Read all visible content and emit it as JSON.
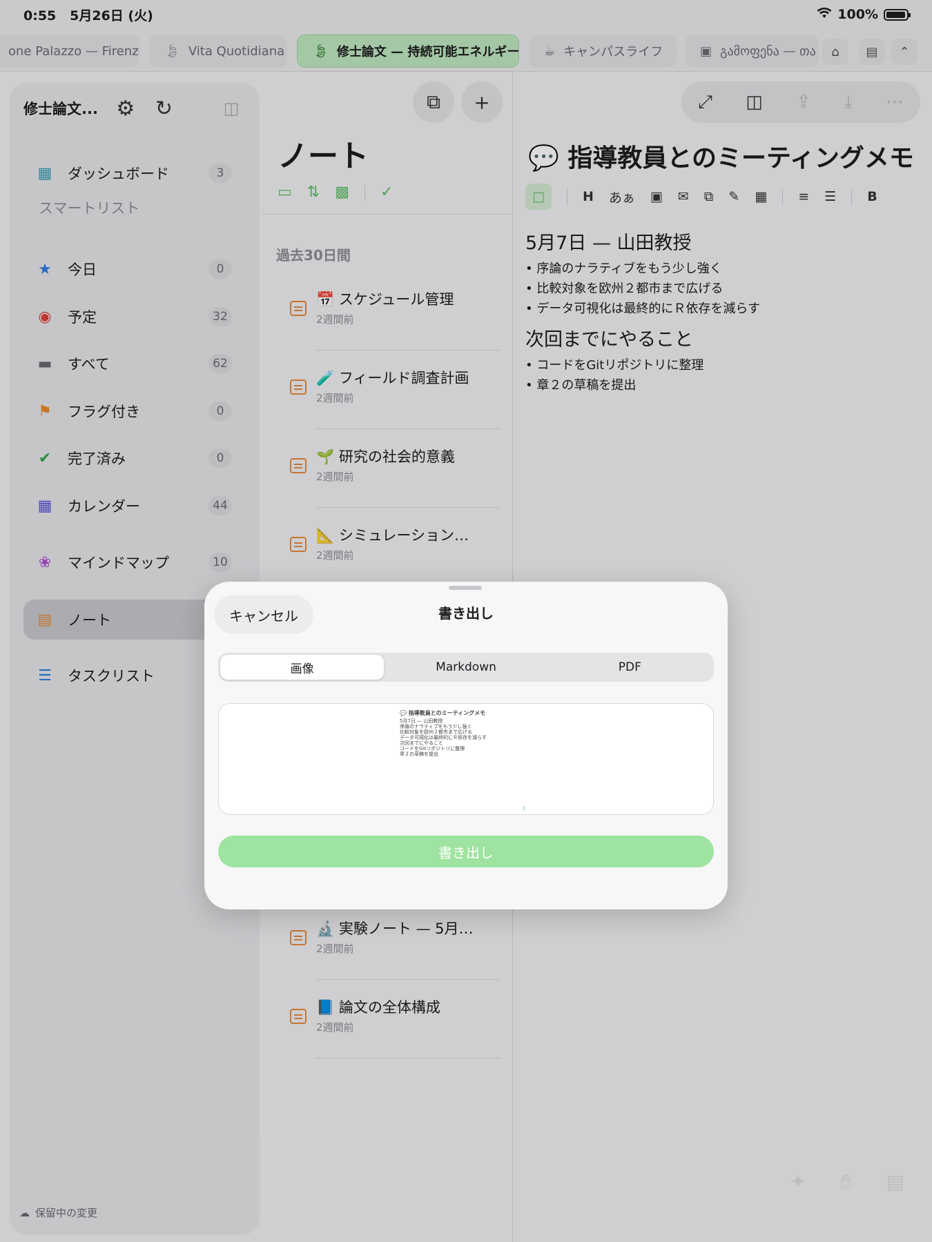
{
  "status": {
    "time": "0:55",
    "date": "5月26日 (火)",
    "battery": "100%",
    "battery_level": 0.95
  },
  "tabs": [
    {
      "label": "one Palazzo — Firenze"
    },
    {
      "label": "Vita Quotidiana"
    },
    {
      "label": "修士論文 — 持続可能エネルギー"
    },
    {
      "label": "キャンパスライフ"
    },
    {
      "label": "გამოფენა — თა"
    }
  ],
  "sidebar": {
    "title": "修士論文...",
    "top_item": {
      "label": "ダッシュボード",
      "count": "3"
    },
    "section": "スマートリスト",
    "items": [
      {
        "label": "今日",
        "count": "0"
      },
      {
        "label": "予定",
        "count": "32"
      },
      {
        "label": "すべて",
        "count": "62"
      },
      {
        "label": "フラグ付き",
        "count": "0"
      },
      {
        "label": "完了済み",
        "count": "0"
      },
      {
        "label": "カレンダー",
        "count": "44"
      }
    ],
    "mindmap": {
      "label": "マインドマップ",
      "count": "10"
    },
    "notes": {
      "label": "ノート"
    },
    "tasklist": {
      "label": "タスクリスト"
    },
    "footer": "保留中の変更"
  },
  "notes": {
    "title": "ノート",
    "section": "過去30日間",
    "items": [
      {
        "title": "📅 スケジュール管理",
        "meta": "2週間前"
      },
      {
        "title": "🧪 フィールド調査計画",
        "meta": "2週間前"
      },
      {
        "title": "🌱 研究の社会的意義",
        "meta": "2週間前"
      },
      {
        "title": "📐 シミュレーション…",
        "meta": "2週間前"
      },
      {
        "title": "🔬 実験ノート — 5月…",
        "meta": "2週間前"
      },
      {
        "title": "📘 論文の全体構成",
        "meta": "2週間前"
      }
    ]
  },
  "editor": {
    "title": "💬 指導教員とのミーティングメモ",
    "format": {
      "heading": "H",
      "text": "あぁ",
      "bold": "B"
    },
    "h1": "5月7日 — 山田教授",
    "list1": [
      "序論のナラティブをもう少し強く",
      "比較対象を欧州２都市まで広げる",
      "データ可視化は最終的にＲ依存を減らす"
    ],
    "h2": "次回までにやること",
    "list2": [
      "コードをGitリポジトリに整理",
      "章２の草稿を提出"
    ]
  },
  "modal": {
    "cancel": "キャンセル",
    "title": "書き出し",
    "segments": [
      "画像",
      "Markdown",
      "PDF"
    ],
    "export": "書き出し"
  },
  "colors": {
    "accent": "#5ebf6a",
    "active_tab": "#bfe8c0",
    "export_button": "#9ee39f",
    "note_icon": "#e7893a"
  }
}
